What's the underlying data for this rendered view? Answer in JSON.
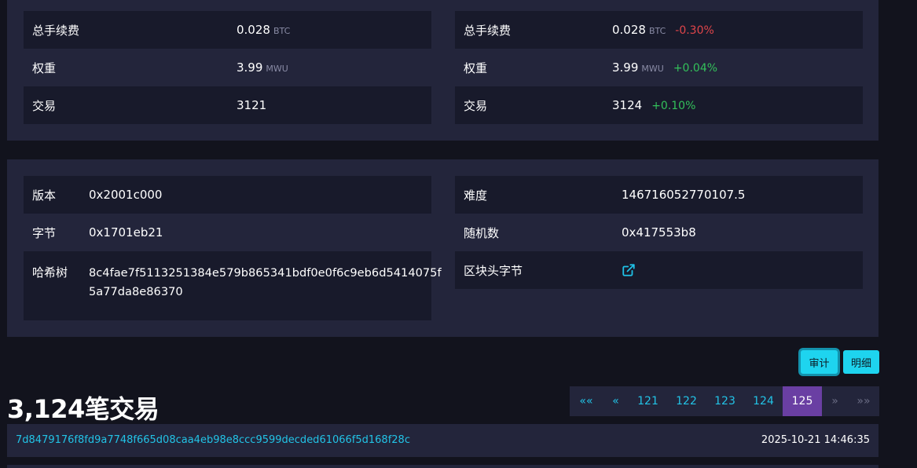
{
  "compare_left": {
    "fee_label": "总手续费",
    "fee_value": "0.028",
    "fee_unit": "BTC",
    "weight_label": "权重",
    "weight_value": "3.99",
    "weight_unit": "MWU",
    "tx_label": "交易",
    "tx_value": "3121"
  },
  "compare_right": {
    "fee_label": "总手续费",
    "fee_value": "0.028",
    "fee_unit": "BTC",
    "fee_change": "-0.30%",
    "weight_label": "权重",
    "weight_value": "3.99",
    "weight_unit": "MWU",
    "weight_change": "+0.04%",
    "tx_label": "交易",
    "tx_value": "3124",
    "tx_change": "+0.10%"
  },
  "details_left": {
    "version_label": "版本",
    "version_value": "0x2001c000",
    "bits_label": "字节",
    "bits_value": "0x1701eb21",
    "merkle_label": "哈希树",
    "merkle_value_line1": "8c4fae7f5113251384e579b865341bdf0e0f6c9eb6d5414075f",
    "merkle_value_line2": "5a77da8e86370"
  },
  "details_right": {
    "difficulty_label": "难度",
    "difficulty_value": "146716052770107.5",
    "nonce_label": "随机数",
    "nonce_value": "0x417553b8",
    "header_label": "区块头字节",
    "header_icon": "external-link-icon"
  },
  "toggle": {
    "audit": "审计",
    "detail": "明细"
  },
  "transactions": {
    "heading": "3,124笔交易",
    "pagination": [
      "««",
      "«",
      "121",
      "122",
      "123",
      "124",
      "125",
      "»",
      "»»"
    ],
    "active_page": "125",
    "first_tx": {
      "hash": "7d8479176f8fd9a7748f665d08caa4eb98e8ccc9599decded61066f5d168f28c",
      "time": "2025-10-21 14:46:35"
    }
  },
  "colors": {
    "accent": "#22c3e6",
    "active_page": "#6a3fa3",
    "negative": "#e0454a",
    "positive": "#33c05a",
    "panel": "#23253b"
  }
}
